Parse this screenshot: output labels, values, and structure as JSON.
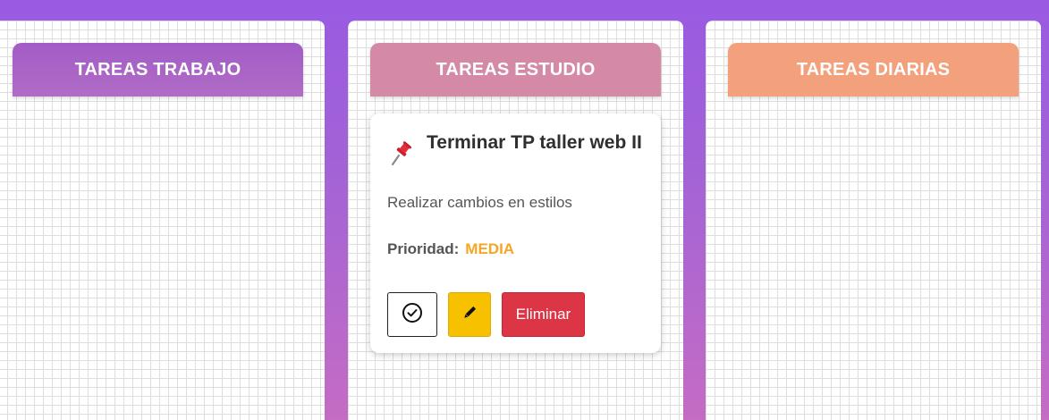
{
  "columns": [
    {
      "title": "TAREAS TRABAJO",
      "color": "#a963c6"
    },
    {
      "title": "TAREAS ESTUDIO",
      "color": "#d48aa6"
    },
    {
      "title": "TAREAS DIARIAS",
      "color": "#f3a07c"
    }
  ],
  "tasks": [
    {
      "icon": "pushpin-icon",
      "title": "Terminar TP taller web II",
      "description": "Realizar cambios en estilos",
      "priority_label": "Prioridad:",
      "priority_value": "MEDIA",
      "priority_color": "#f5a623",
      "actions": {
        "complete_icon": "check-circle-icon",
        "edit_icon": "pencil-icon",
        "delete_label": "Eliminar"
      }
    }
  ]
}
